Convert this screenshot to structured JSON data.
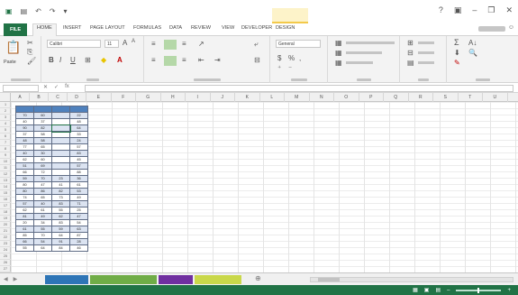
{
  "titlebar": {
    "window_title": ""
  },
  "ribbon_tabs": [
    "FILE",
    "HOME",
    "INSERT",
    "PAGE LAYOUT",
    "FORMULAS",
    "DATA",
    "REVIEW",
    "VIEW",
    "DEVELOPER",
    "DESIGN"
  ],
  "active_tab_index": 1,
  "ribbon": {
    "paste_label": "Paste",
    "font_name": "Calibri",
    "font_size": "11",
    "bold": "B",
    "italic": "I",
    "underline": "U",
    "number_format": "General",
    "currency": "$",
    "percent": "%",
    "comma": ",",
    "autosum": "Σ",
    "sort_filter": "A↓",
    "find": "🔍"
  },
  "formula_bar": {
    "name_box": "",
    "fx": "fx",
    "formula": ""
  },
  "columns": [
    "A",
    "B",
    "C",
    "D",
    "E",
    "F",
    "G",
    "H",
    "I",
    "J",
    "K",
    "L",
    "M",
    "N",
    "O",
    "P",
    "Q",
    "R",
    "S",
    "T",
    "U"
  ],
  "rows": [
    "1",
    "2",
    "3",
    "4",
    "5",
    "6",
    "7",
    "8",
    "9",
    "10",
    "11",
    "12",
    "13",
    "14",
    "15",
    "16",
    "17",
    "18",
    "19",
    "20",
    "21",
    "22",
    "23",
    "24",
    "25",
    "26",
    "27"
  ],
  "table": {
    "headers": [
      "",
      "",
      "",
      ""
    ],
    "rows": [
      [
        "70",
        "60",
        "",
        "22"
      ],
      [
        "40",
        "37",
        "",
        "48"
      ],
      [
        "90",
        "82",
        "",
        "64"
      ],
      [
        "37",
        "58",
        "",
        "33"
      ],
      [
        "48",
        "58",
        "",
        "24"
      ],
      [
        "77",
        "65",
        "",
        "57"
      ],
      [
        "40",
        "30",
        "",
        "83"
      ],
      [
        "62",
        "60",
        "",
        "45"
      ],
      [
        "51",
        "69",
        "",
        "57"
      ],
      [
        "66",
        "72",
        "",
        "88"
      ],
      [
        "59",
        "70",
        "23",
        "36"
      ],
      [
        "80",
        "47",
        "41",
        "61"
      ],
      [
        "80",
        "86",
        "82",
        "53"
      ],
      [
        "74",
        "65",
        "73",
        "49"
      ],
      [
        "57",
        "40",
        "83",
        "71"
      ],
      [
        "62",
        "61",
        "55",
        "25"
      ],
      [
        "81",
        "49",
        "62",
        "47"
      ],
      [
        "20",
        "34",
        "83",
        "54"
      ],
      [
        "61",
        "55",
        "59",
        "63"
      ],
      [
        "85",
        "70",
        "64",
        "87"
      ],
      [
        "66",
        "54",
        "91",
        "28"
      ],
      [
        "55",
        "64",
        "84",
        "46"
      ]
    ]
  },
  "sheet_tabs": [
    {
      "label": "",
      "color": "#2e75b6"
    },
    {
      "label": "",
      "color": "#70ad47"
    },
    {
      "label": "",
      "color": "#7030a0"
    },
    {
      "label": "",
      "color": "#c9d84a"
    }
  ],
  "status": {
    "ready": ""
  },
  "colors": {
    "excel_green": "#217346",
    "table_header": "#4f81bd",
    "table_band": "#dbe3f1"
  }
}
